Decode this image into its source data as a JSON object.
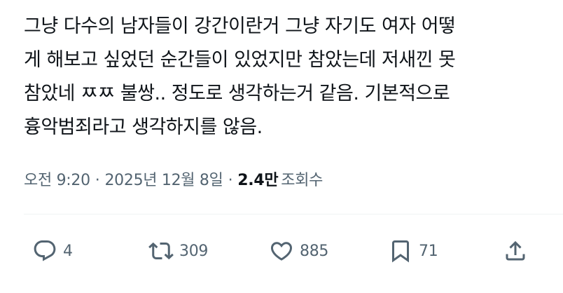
{
  "tweet": {
    "lines": [
      "그냥 다수의 남자들이 강간이란거 그냥 자기도 여자 어떻",
      "게 해보고 싶었던 순간들이 있었지만 참았는데 저새낀 못",
      "참았네 ㅉㅉ 불쌍.. 정도로 생각하는거 같음. 기본적으로",
      "흉악범죄라고 생각하지를 않음."
    ]
  },
  "meta": {
    "time": "오전 9:20",
    "separator": "·",
    "date": "2025년 12월 8일",
    "views_count": "2.4만",
    "views_label": "조회수"
  },
  "actions": {
    "reply": {
      "icon": "reply-icon",
      "count": "4"
    },
    "retweet": {
      "icon": "retweet-icon",
      "count": "309"
    },
    "like": {
      "icon": "heart-icon",
      "count": "885"
    },
    "bookmark": {
      "icon": "bookmark-icon",
      "count": "71"
    },
    "share": {
      "icon": "share-icon"
    }
  },
  "colors": {
    "text": "#0f1419",
    "secondary": "#536471",
    "divider": "#eff3f4",
    "background": "#ffffff"
  }
}
